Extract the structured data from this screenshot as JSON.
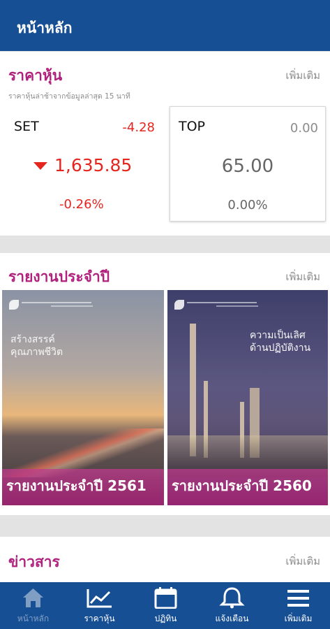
{
  "header": {
    "title": "หน้าหลัก"
  },
  "stock_section": {
    "title": "ราคาหุ้น",
    "more": "เพิ่มเติม",
    "note": "ราคาหุ้นล่าช้าจากข้อมูลล่าสุด 15 นาที",
    "set": {
      "name": "SET",
      "change": "-4.28",
      "price": "1,635.85",
      "percent": "-0.26%"
    },
    "top": {
      "name": "TOP",
      "change": "0.00",
      "price": "65.00",
      "percent": "0.00%"
    },
    "colors": {
      "down": "#e5261f",
      "neutral": "#666666"
    }
  },
  "annual_section": {
    "title": "รายงานประจำปี",
    "more": "เพิ่มเติม",
    "reports": [
      {
        "caption": "รายงานประจำปี 2561",
        "cover_title": "สร้างสรรค์\nคุณภาพชีวิต"
      },
      {
        "caption": "รายงานประจำปี 2560",
        "cover_title": "ความเป็นเลิศ\nด้านปฏิบัติงาน"
      }
    ]
  },
  "news_section": {
    "title": "ข่าวสาร",
    "more": "เพิ่มเติม"
  },
  "bottom_nav": [
    {
      "label": "หน้าหลัก",
      "icon": "home-icon",
      "active": true
    },
    {
      "label": "ราคาหุ้น",
      "icon": "chart-icon",
      "active": false
    },
    {
      "label": "ปฏิทิน",
      "icon": "calendar-icon",
      "active": false
    },
    {
      "label": "แจ้งเตือน",
      "icon": "bell-icon",
      "active": false
    },
    {
      "label": "เพิ่มเติม",
      "icon": "menu-icon",
      "active": false
    }
  ],
  "theme": {
    "primary": "#174f94",
    "accent": "#b0217d"
  }
}
